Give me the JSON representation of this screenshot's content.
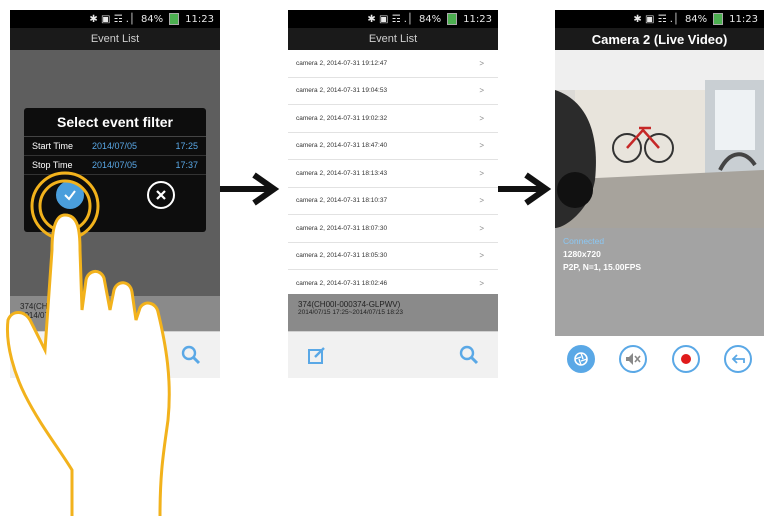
{
  "status_bar": {
    "time_text": "11:23",
    "signal_text": "84%",
    "icons_text": "✱ ▣ ☶ .│"
  },
  "screen1": {
    "title": "Event List",
    "dialog": {
      "title": "Select event filter",
      "start_label": "Start Time",
      "start_date": "2014/07/05",
      "start_time": "17:25",
      "stop_label": "Stop Time",
      "stop_date": "2014/07/05",
      "stop_time": "17:37"
    },
    "info_line1": "374(CH00I-",
    "info_line2": "2014/07/15"
  },
  "screen2": {
    "title": "Event List",
    "events": [
      "camera 2, 2014-07-31 19:12:47",
      "camera 2, 2014-07-31 19:04:53",
      "camera 2, 2014-07-31 19:02:32",
      "camera 2, 2014-07-31 18:47:40",
      "camera 2, 2014-07-31 18:13:43",
      "camera 2, 2014-07-31 18:10:37",
      "camera 2, 2014-07-31 18:07:30",
      "camera 2, 2014-07-31 18:05:30",
      "camera 2, 2014-07-31 18:02:46"
    ],
    "chevron": ">",
    "info_line1": "374(CH00I-000374-GLPWV)",
    "info_line2": "2014/07/15 17:25~2014/07/15 18:23"
  },
  "screen3": {
    "title": "Camera 2 (Live Video)",
    "connected": "Connected",
    "resolution": "1280x720",
    "stream_info": "P2P, N=1, 15.00FPS"
  },
  "colors": {
    "accent": "#5aa8e6",
    "hand_stroke": "#f2b21c",
    "record": "#e01a1a"
  },
  "icons": [
    "check-icon",
    "close-icon",
    "edit-icon",
    "search-icon",
    "shutter-icon",
    "mute-icon",
    "record-icon",
    "back-icon",
    "arrow-right-icon",
    "hand-pointer-icon"
  ]
}
